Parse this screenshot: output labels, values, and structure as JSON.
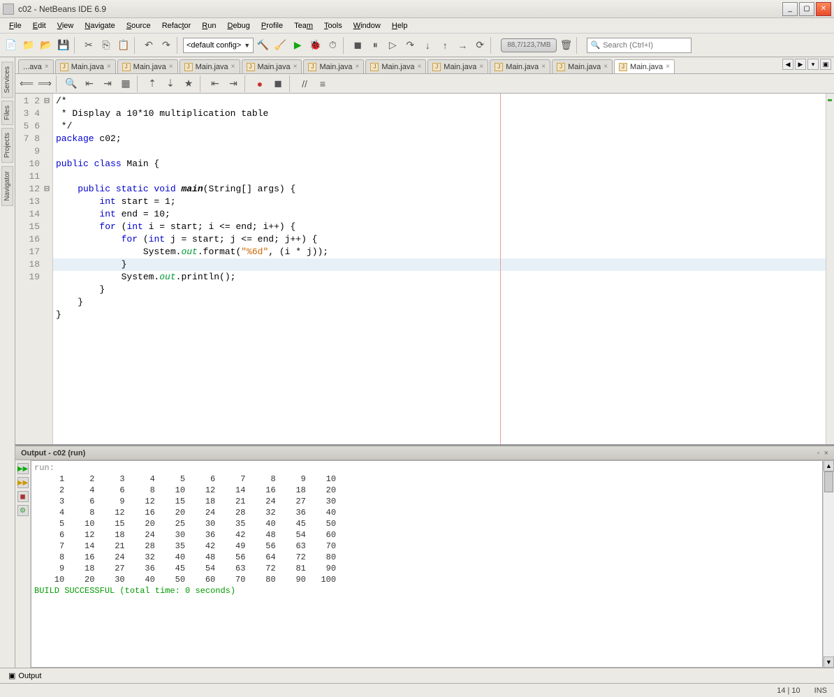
{
  "window": {
    "title": "c02 - NetBeans IDE 6.9"
  },
  "menubar": [
    "File",
    "Edit",
    "View",
    "Navigate",
    "Source",
    "Refactor",
    "Run",
    "Debug",
    "Profile",
    "Team",
    "Tools",
    "Window",
    "Help"
  ],
  "config_combo": "<default config>",
  "memory": "88,7/123,7MB",
  "search_placeholder": "Search (Ctrl+I)",
  "left_dock": [
    "Services",
    "Files",
    "Projects",
    "Navigator"
  ],
  "file_tabs": {
    "overflow": "...ava",
    "items": [
      "Main.java",
      "Main.java",
      "Main.java",
      "Main.java",
      "Main.java",
      "Main.java",
      "Main.java",
      "Main.java",
      "Main.java",
      "Main.java"
    ],
    "active_index": 9
  },
  "code": {
    "lines": [
      1,
      2,
      3,
      4,
      5,
      6,
      7,
      8,
      9,
      10,
      11,
      12,
      13,
      14,
      15,
      16,
      17,
      18,
      19
    ],
    "highlight_line": 14,
    "l1": "/*",
    "l2": " * Display a 10*10 multiplication table",
    "l3": " */",
    "l4a": "package",
    "l4b": " c02;",
    "l6a": "public class",
    "l6b": " Main {",
    "l8a": "    public static void ",
    "l8b": "main",
    "l8c": "(String[] args) {",
    "l9a": "        int",
    "l9b": " start = 1;",
    "l10a": "        int",
    "l10b": " end = 10;",
    "l11a": "        for",
    "l11b": " (",
    "l11c": "int",
    "l11d": " i = start; i <= end; i++) {",
    "l12a": "            for",
    "l12b": " (",
    "l12c": "int",
    "l12d": " j = start; j <= end; j++) {",
    "l13a": "                System.",
    "l13b": "out",
    "l13c": ".format(",
    "l13d": "\"%6d\"",
    "l13e": ", (i * j));",
    "l14": "            }",
    "l15a": "            System.",
    "l15b": "out",
    "l15c": ".println();",
    "l16": "        }",
    "l17": "    }",
    "l18": "}"
  },
  "output": {
    "title": "Output - c02 (run)",
    "run_label": "run:",
    "table": [
      [
        1,
        2,
        3,
        4,
        5,
        6,
        7,
        8,
        9,
        10
      ],
      [
        2,
        4,
        6,
        8,
        10,
        12,
        14,
        16,
        18,
        20
      ],
      [
        3,
        6,
        9,
        12,
        15,
        18,
        21,
        24,
        27,
        30
      ],
      [
        4,
        8,
        12,
        16,
        20,
        24,
        28,
        32,
        36,
        40
      ],
      [
        5,
        10,
        15,
        20,
        25,
        30,
        35,
        40,
        45,
        50
      ],
      [
        6,
        12,
        18,
        24,
        30,
        36,
        42,
        48,
        54,
        60
      ],
      [
        7,
        14,
        21,
        28,
        35,
        42,
        49,
        56,
        63,
        70
      ],
      [
        8,
        16,
        24,
        32,
        40,
        48,
        56,
        64,
        72,
        80
      ],
      [
        9,
        18,
        27,
        36,
        45,
        54,
        63,
        72,
        81,
        90
      ],
      [
        10,
        20,
        30,
        40,
        50,
        60,
        70,
        80,
        90,
        100
      ]
    ],
    "success": "BUILD SUCCESSFUL (total time: 0 seconds)"
  },
  "bottom_tab": "Output",
  "status": {
    "pos": "14 | 10",
    "mode": "INS"
  }
}
